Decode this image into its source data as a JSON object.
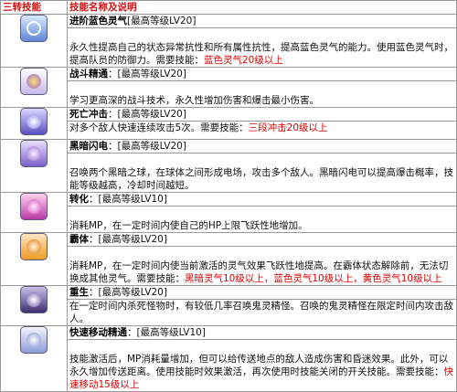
{
  "header": {
    "col_skill": "三转技能",
    "col_desc": "技能名称及说明"
  },
  "skills": [
    {
      "icon": "blue-swirl-aura-icon",
      "name": "进阶蓝色灵气",
      "level": "[最高等级LV20]",
      "desc": "永久性提高自己的状态异常抗性和所有属性抗性，提高蓝色灵气的能力。使用蓝色灵气时，提高队员的防御力。需要技能：",
      "req": "蓝色灵气20级以上"
    },
    {
      "icon": "battle-mastery-icon",
      "name": "战斗精通",
      "level": "：[最高等级LV20]",
      "desc": "学习更高深的战斗技术，永久性增加伤害和爆击最小伤害。",
      "req": ""
    },
    {
      "icon": "death-strike-icon",
      "name": "死亡冲击",
      "level": "：[最高等级LV20]",
      "desc": "对多个敌人快速连续攻击5次。需要技能：",
      "req": "三段冲击20级以上"
    },
    {
      "icon": "dark-lightning-icon",
      "name": "黑暗闪电",
      "level": "：[最高等级LV20]",
      "desc": "召唤两个黑暗之球，在球体之间形成电场，攻击多个敌人。黑暗闪电可以提高爆击概率，技能等级越高，冷却时间越短。",
      "req": ""
    },
    {
      "icon": "transform-icon",
      "name": "转化",
      "level": "：[最高等级LV10]",
      "desc": "消耗MP，在一定时间内使自己的HP上限飞跃性地增加。",
      "req": ""
    },
    {
      "icon": "dominion-icon",
      "name": "霸体",
      "level": "：[最高等级LV20]",
      "desc": "消耗MP，在一定时间内使当前激活的灵气效果飞跃性地提高。在霸体状态解除前，无法切换成其他灵气。需要技能：",
      "req": "黑暗灵气10级以上，蓝色灵气10级以上，黄色灵气10级以上"
    },
    {
      "icon": "revive-icon",
      "name": "重生",
      "level": "：[最高等级LV20]",
      "desc": "在一定时间内杀死怪物时，有较低几率召唤鬼灵精怪。召唤的鬼灵精怪在限定时间内攻击敌人。",
      "req": ""
    },
    {
      "icon": "teleport-mastery-icon",
      "name": "快速移动精通",
      "level": "：[最高等级LV10]",
      "desc": "技能激活后，MP消耗量增加，但可以给传送地点的敌人造成伤害和昏迷效果。此外，可以永久增加传送距离。使用技能时效果激活，再次使用时技能关闭的开关技能。需要技能：",
      "req": "快速移动15级以上"
    }
  ]
}
